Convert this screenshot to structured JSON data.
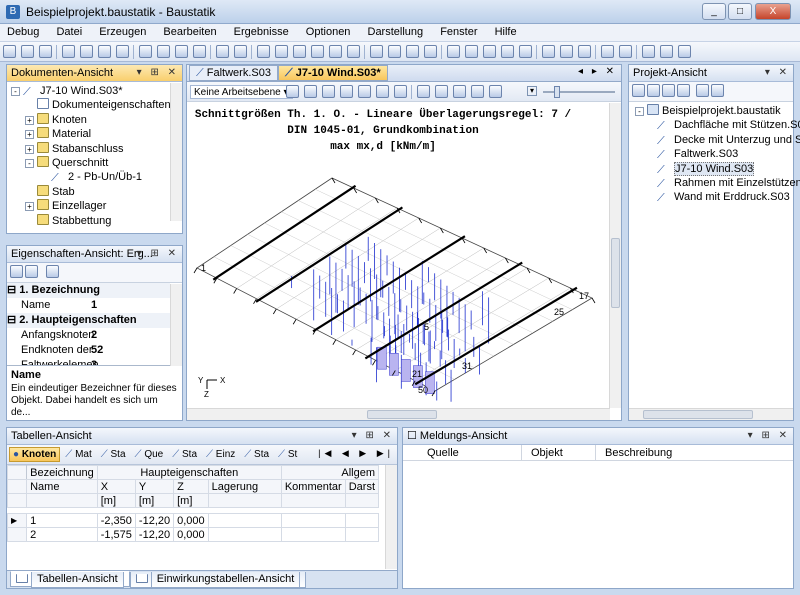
{
  "window": {
    "title": "Beispielprojekt.baustatik - Baustatik",
    "min": "_",
    "max": "□",
    "close": "X"
  },
  "menu": [
    "Debug",
    "Datei",
    "Erzeugen",
    "Bearbeiten",
    "Ergebnisse",
    "Optionen",
    "Darstellung",
    "Fenster",
    "Hilfe"
  ],
  "documents_panel": {
    "title": "Dokumenten-Ansicht",
    "items": [
      {
        "label": "J7-10 Wind.S03*",
        "indent": 0,
        "icon": "beam-icon",
        "expander": "-"
      },
      {
        "label": "Dokumenteigenschaften",
        "indent": 1,
        "icon": "doc-icon",
        "expander": ""
      },
      {
        "label": "Knoten",
        "indent": 1,
        "icon": "folder-icon",
        "expander": "+"
      },
      {
        "label": "Material",
        "indent": 1,
        "icon": "folder-icon",
        "expander": "+"
      },
      {
        "label": "Stabanschluss",
        "indent": 1,
        "icon": "folder-icon",
        "expander": "+"
      },
      {
        "label": "Querschnitt",
        "indent": 1,
        "icon": "folder-icon",
        "expander": "-"
      },
      {
        "label": "2 - Pb-Un/Üb-1",
        "indent": 2,
        "icon": "beam-icon",
        "expander": ""
      },
      {
        "label": "Stab",
        "indent": 1,
        "icon": "folder-icon",
        "expander": ""
      },
      {
        "label": "Einzellager",
        "indent": 1,
        "icon": "folder-icon",
        "expander": "+"
      },
      {
        "label": "Stabbettung",
        "indent": 1,
        "icon": "folder-icon",
        "expander": ""
      }
    ]
  },
  "properties_panel": {
    "title": "Eigenschaften-Ansicht:  Erg...",
    "groups": [
      {
        "label": "1. Bezeichnung",
        "rows": [
          {
            "name": "Name",
            "value": "1"
          }
        ]
      },
      {
        "label": "2. Haupteigenschaften",
        "rows": [
          {
            "name": "Anfangsknoten",
            "value": "2"
          },
          {
            "name": "Endknoten der",
            "value": "52"
          },
          {
            "name": "Faltwerkelemen",
            "value": "3"
          }
        ]
      }
    ],
    "desc_title": "Name",
    "desc_text": "Ein eindeutiger Bezeichner für dieses Objekt. Dabei handelt es sich um de..."
  },
  "doc_tabs": [
    {
      "label": "Faltwerk.S03",
      "selected": false
    },
    {
      "label": "J7-10 Wind.S03*",
      "selected": true
    }
  ],
  "view_toolbar": {
    "dropdown": "Keine Arbeitsebene"
  },
  "viewport": {
    "title_lines": [
      "Schnittgrößen Th. 1. O. - Lineare Überlagerungsregel: 7 /",
      "DIN 1045-01, Grundkombination",
      "max mx,d [kNm/m]"
    ],
    "node_labels": [
      "5",
      "21",
      "17",
      "25",
      "31",
      "50",
      "1"
    ],
    "axis_labels": [
      "Y",
      "X",
      "Z"
    ]
  },
  "project_panel": {
    "title": "Projekt-Ansicht",
    "root": "Beispielprojekt.baustatik",
    "items": [
      "Dachfläche mit Stützen.S03",
      "Decke mit Unterzug und St",
      "Faltwerk.S03",
      "J7-10 Wind.S03",
      "Rahmen mit Einzelstützen.S",
      "Wand mit Erddruck.S03"
    ],
    "selected_index": 3
  },
  "table_panel": {
    "title": "Tabellen-Ansicht",
    "tabs": [
      {
        "label": "Knoten",
        "selected": true
      },
      {
        "label": "Mat",
        "selected": false
      },
      {
        "label": "Sta",
        "selected": false
      },
      {
        "label": "Que",
        "selected": false
      },
      {
        "label": "Sta",
        "selected": false
      },
      {
        "label": "Einz",
        "selected": false
      },
      {
        "label": "Sta",
        "selected": false
      },
      {
        "label": "St",
        "selected": false
      }
    ],
    "header_group": {
      "bezeichnung": "Bezeichnung",
      "haupt": "Haupteigenschaften",
      "allgem": "Allgem"
    },
    "columns": [
      "Name",
      "X",
      "Y",
      "Z",
      "Lagerung",
      "Kommentar",
      "Darst"
    ],
    "units": [
      "",
      "[m]",
      "[m]",
      "[m]",
      "",
      "",
      ""
    ],
    "rows": [
      {
        "name": "1",
        "x": "-2,350",
        "y": "-12,20",
        "z": "0,000"
      },
      {
        "name": "2",
        "x": "-1,575",
        "y": "-12,20",
        "z": "0,000"
      }
    ],
    "bottom_tabs": [
      {
        "label": "Tabellen-Ansicht",
        "selected": true
      },
      {
        "label": "Einwirkungstabellen-Ansicht",
        "selected": false
      }
    ]
  },
  "messages_panel": {
    "title": "Meldungs-Ansicht",
    "columns": [
      "Quelle",
      "Objekt",
      "Beschreibung"
    ]
  }
}
